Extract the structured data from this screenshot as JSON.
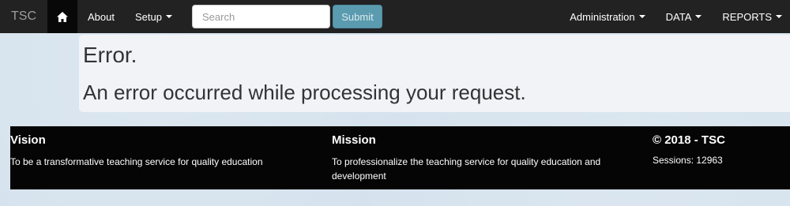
{
  "navbar": {
    "brand": "TSC",
    "home_icon": "home-icon",
    "links": {
      "about": "About",
      "setup": "Setup"
    },
    "search": {
      "placeholder": "Search",
      "value": ""
    },
    "submit_label": "Submit",
    "right_links": {
      "administration": "Administration",
      "data": "DATA",
      "reports": "REPORTS"
    }
  },
  "error": {
    "title": "Error.",
    "message": "An error occurred while processing your request."
  },
  "footer": {
    "vision": {
      "heading": "Vision",
      "text": "To be a transformative teaching service for quality education"
    },
    "mission": {
      "heading": "Mission",
      "text_line1": "To professionalize the teaching service for quality education and",
      "text_line2": "development"
    },
    "copyright": "© 2018 - TSC",
    "sessions": "Sessions: 12963"
  },
  "colors": {
    "navbar_bg": "#222222",
    "submit_bg": "#5a9bb0",
    "footer_bg": "#050505",
    "page_bg": "#d5e2ed"
  }
}
